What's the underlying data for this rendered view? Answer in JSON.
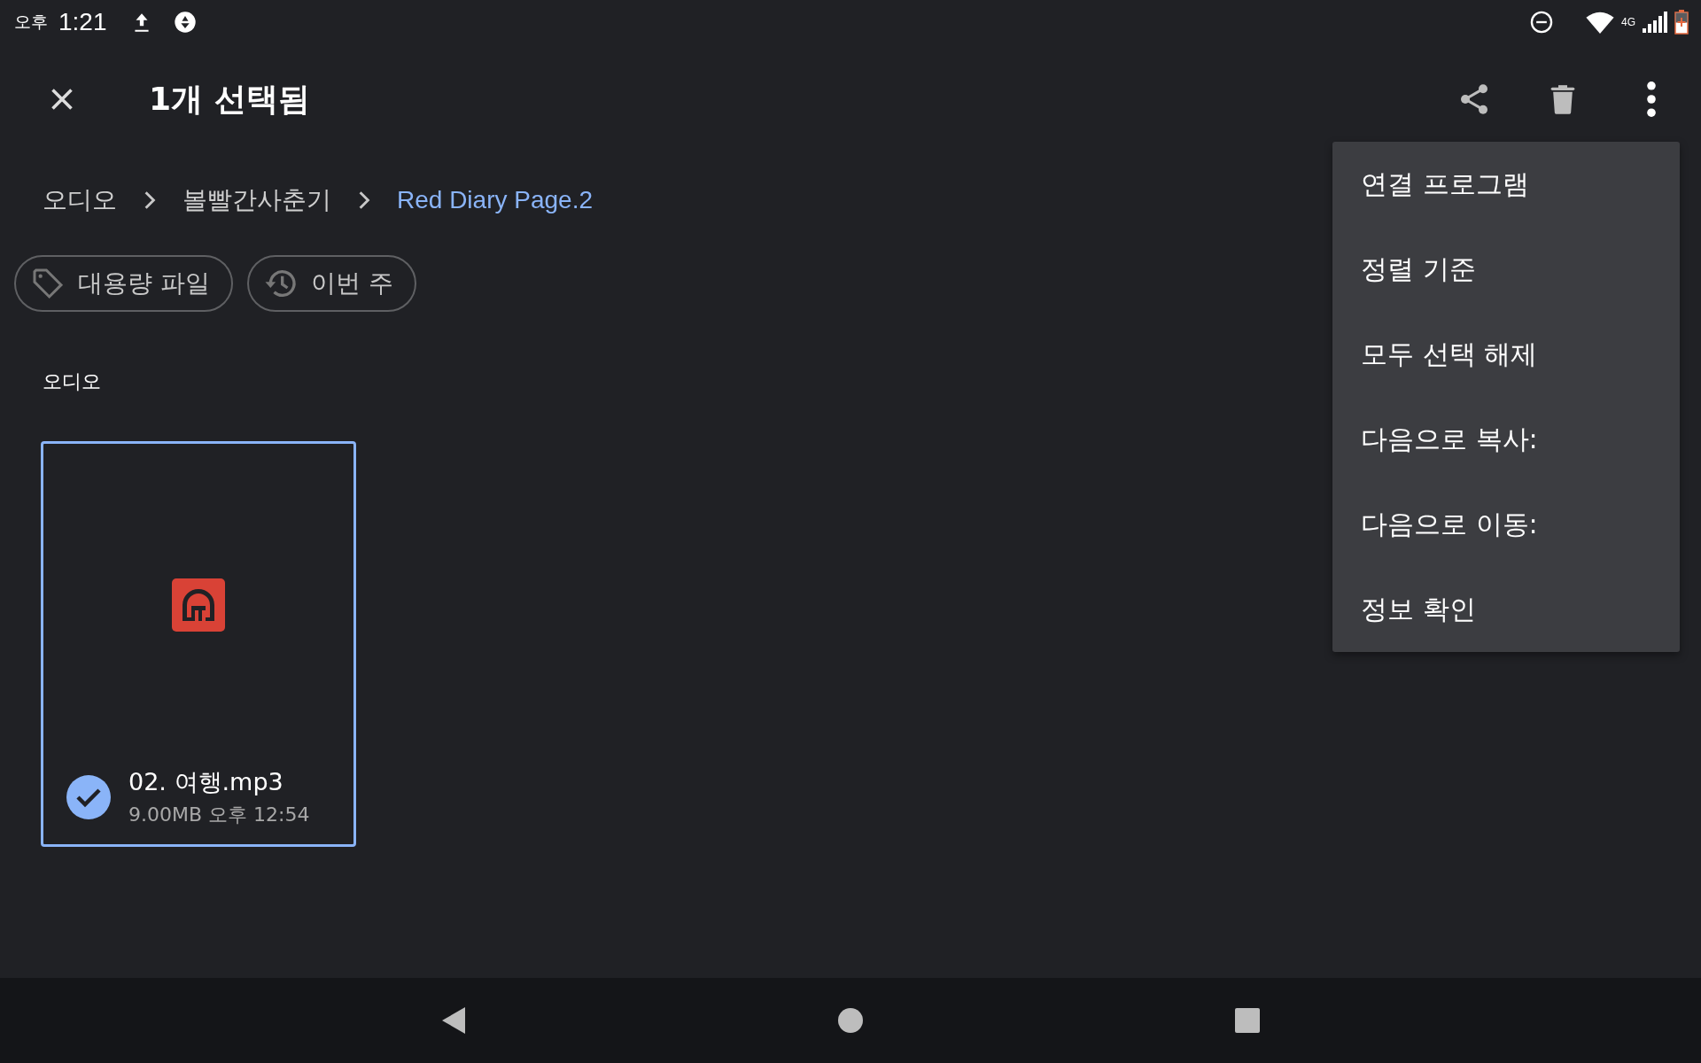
{
  "status_bar": {
    "ampm": "오후",
    "time": "1:21",
    "network": "4G"
  },
  "app_bar": {
    "title": "1개 선택됨"
  },
  "breadcrumb": [
    {
      "label": "오디오",
      "current": false
    },
    {
      "label": "볼빨간사춘기",
      "current": false
    },
    {
      "label": "Red Diary Page.2",
      "current": true
    }
  ],
  "chips": [
    {
      "label": "대용량 파일",
      "kind": "tag"
    },
    {
      "label": "이번 주",
      "kind": "history"
    }
  ],
  "section": {
    "title": "오디오"
  },
  "files": [
    {
      "name": "02. 여행.mp3",
      "meta": "9.00MB 오후 12:54",
      "selected": true
    }
  ],
  "menu": {
    "items": [
      "연결 프로그램",
      "정렬 기준",
      "모두 선택 해제",
      "다음으로 복사:",
      "다음으로 이동:",
      "정보 확인"
    ]
  }
}
